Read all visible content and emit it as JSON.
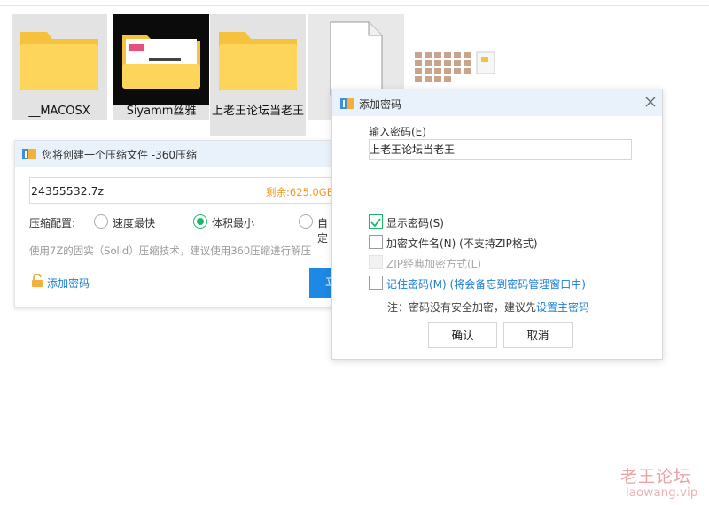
{
  "files": [
    {
      "name": "__MACOSX",
      "icon": "folder-icon"
    },
    {
      "name": "Siyamm丝雅",
      "icon": "folder-preview-icon"
    },
    {
      "name": "上老王论坛当老王",
      "icon": "folder-icon"
    },
    {
      "name": "",
      "icon": "blank-file-icon"
    }
  ],
  "compress_panel": {
    "title": "您将创建一个压缩文件 -360压缩",
    "file_name": "24355532.7z",
    "free_space": "剩余:625.0GB",
    "config_label": "压缩配置:",
    "options": [
      "速度最快",
      "体积最小",
      "自定"
    ],
    "selected_option": "体积最小",
    "hint": "使用7Z的固实（Solid）压缩技术，建议使用360压缩进行解压",
    "add_password": "添加密码",
    "start_button": "立即"
  },
  "password_dialog": {
    "title": "添加密码",
    "input_label": "输入密码(E)",
    "password_value": "上老王论坛当老王",
    "show_password": {
      "label": "显示密码(S)",
      "checked": true
    },
    "encrypt_names": {
      "label": "加密文件名(N) (不支持ZIP格式)",
      "checked": false
    },
    "zip_classic": {
      "label": "ZIP经典加密方式(L)",
      "checked": false,
      "disabled": true
    },
    "remember": {
      "label": "记住密码(M) (将会备忘到密码管理窗口中)",
      "checked": false
    },
    "note_prefix": "注：密码没有安全加密，建议先",
    "note_link": "设置主密码",
    "ok": "确认",
    "cancel": "取消"
  },
  "watermark": {
    "line1": "老王论坛",
    "line2": "laowang.vip"
  },
  "colors": {
    "accent_blue": "#1a7fd4",
    "accent_green": "#21b66e",
    "header_bg": "#e9f1fa",
    "free_space_orange": "#f39a1d"
  }
}
